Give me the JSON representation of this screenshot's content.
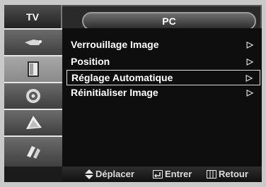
{
  "tabs": {
    "tv": "TV",
    "pc": "PC"
  },
  "menu": {
    "items": [
      {
        "label": "Verrouillage Image",
        "arrow": "▷"
      },
      {
        "label": "Position",
        "arrow": "▷"
      },
      {
        "label": "Réglage Automatique",
        "arrow": "▷"
      },
      {
        "label": "Réinitialiser Image",
        "arrow": "▷"
      }
    ],
    "selected_index": 2
  },
  "sidebar": {
    "items": [
      "input-icon",
      "picture-icon",
      "sound-icon",
      "channel-icon",
      "setup-icon"
    ]
  },
  "footer": {
    "move_label": "Déplacer",
    "enter_label": "Entrer",
    "return_label": "Retour"
  },
  "colors": {
    "text": "#ffffff",
    "panel": "#0e0e0e",
    "frame": "#2a2a2a"
  }
}
